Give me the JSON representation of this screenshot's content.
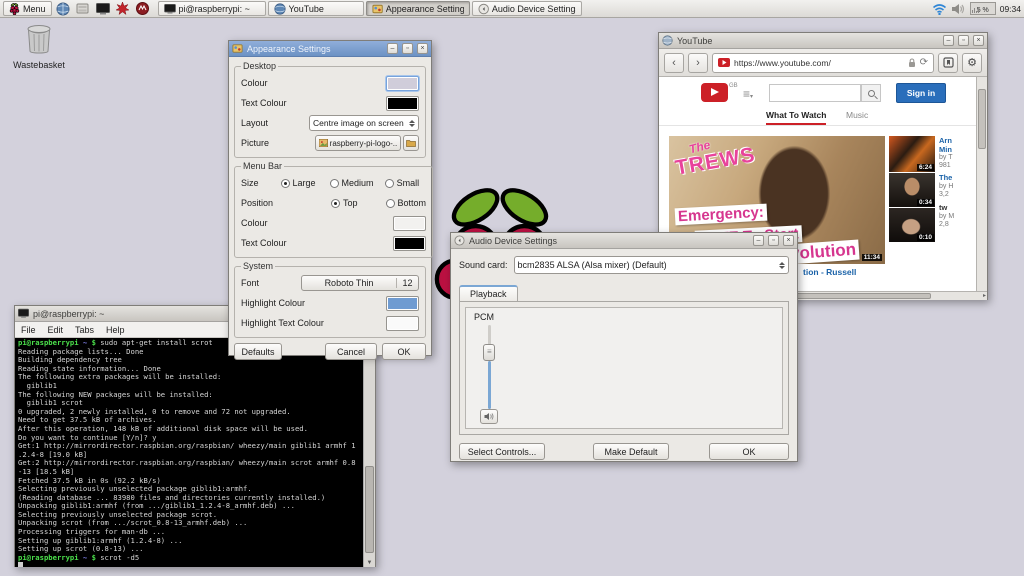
{
  "colors": {
    "desktop_bg": "#d3d1dc",
    "active_titlebar_blue": "#7d9fd0",
    "desktop_colour_swatch": "#d3d1dc",
    "text_colour_swatch": "#000000",
    "menubar_colour_swatch": "#f2f1ef",
    "highlight_colour_swatch": "#6f9bd1",
    "highlight_text_colour_swatch": "#fafafa",
    "youtube_red": "#cc2027",
    "signin_blue": "#2a6ebb",
    "thumb_pink": "#e8439b",
    "terminal_prompt_green": "#4be04b",
    "terminal_path_blue": "#8585f2"
  },
  "taskbar": {
    "menu_label": "Menu",
    "task_terminal": "pi@raspberrypi: ~",
    "task_youtube": "YouTube",
    "task_appearance": "Appearance Settings",
    "task_audio": "Audio Device Settings",
    "cpu": "5 %",
    "clock": "09:34"
  },
  "desktop": {
    "wastebasket_label": "Wastebasket"
  },
  "appearance": {
    "title": "Appearance Settings",
    "desktop_legend": "Desktop",
    "colour_label": "Colour",
    "text_colour_label": "Text Colour",
    "layout_label": "Layout",
    "layout_value": "Centre image on screen",
    "picture_label": "Picture",
    "picture_value": "raspberry-pi-logo-...",
    "menubar_legend": "Menu Bar",
    "size_label": "Size",
    "size_large": "Large",
    "size_medium": "Medium",
    "size_small": "Small",
    "position_label": "Position",
    "position_top": "Top",
    "position_bottom": "Bottom",
    "mb_colour_label": "Colour",
    "mb_text_colour_label": "Text Colour",
    "system_legend": "System",
    "font_label": "Font",
    "font_name": "Roboto Thin",
    "font_size": "12",
    "highlight_colour_label": "Highlight Colour",
    "highlight_text_colour_label": "Highlight Text Colour",
    "defaults_button": "Defaults",
    "cancel_button": "Cancel",
    "ok_button": "OK"
  },
  "audio": {
    "title": "Audio Device Settings",
    "sound_card_label": "Sound card:",
    "sound_card_value": "bcm2835 ALSA (Alsa mixer) (Default)",
    "playback_tab": "Playback",
    "channel_label": "PCM",
    "select_controls_button": "Select Controls...",
    "make_default_button": "Make Default",
    "ok_button": "OK"
  },
  "youtube": {
    "title": "YouTube",
    "url": "https://www.youtube.com/",
    "region": "GB",
    "signin_button": "Sign in",
    "tab_what_to_watch": "What To Watch",
    "tab_music": "Music",
    "thumb_brand_the": "The",
    "thumb_brand": "TREWS",
    "thumb_line1": "Emergency:",
    "thumb_line2": "VOTE To Start",
    "thumb_line3": "volution",
    "main_duration": "11:34",
    "main_title_visible": "tion - Russell",
    "side": [
      {
        "duration": "6:24",
        "title1": "Arn",
        "title2": "Min",
        "meta1": "by T",
        "meta2": "981"
      },
      {
        "duration": "0:34",
        "title1": "The",
        "title2": "",
        "meta1": "by H",
        "meta2": "3,2"
      },
      {
        "duration": "0:10",
        "title1": "tw",
        "title2": "",
        "meta1": "by M",
        "meta2": "2,8"
      }
    ]
  },
  "terminal": {
    "title": "pi@raspberrypi: ~",
    "menu_file": "File",
    "menu_edit": "Edit",
    "menu_tabs": "Tabs",
    "menu_help": "Help",
    "prompt_user": "pi@raspberrypi",
    "prompt_path": "~",
    "prompt_symbol": "$",
    "command1": "sudo apt-get install scrot",
    "command2": "scrot -d5",
    "output": [
      "Reading package lists... Done",
      "Building dependency tree",
      "Reading state information... Done",
      "The following extra packages will be installed:",
      "  giblib1",
      "The following NEW packages will be installed:",
      "  giblib1 scrot",
      "0 upgraded, 2 newly installed, 0 to remove and 72 not upgraded.",
      "Need to get 37.5 kB of archives.",
      "After this operation, 148 kB of additional disk space will be used.",
      "Do you want to continue [Y/n]? y",
      "Get:1 http://mirrordirector.raspbian.org/raspbian/ wheezy/main giblib1 armhf 1",
      ".2.4-8 [19.0 kB]",
      "Get:2 http://mirrordirector.raspbian.org/raspbian/ wheezy/main scrot armhf 0.8",
      "-13 [18.5 kB]",
      "Fetched 37.5 kB in 0s (92.2 kB/s)",
      "Selecting previously unselected package giblib1:armhf.",
      "(Reading database ... 83980 files and directories currently installed.)",
      "Unpacking giblib1:armhf (from .../giblib1_1.2.4-8_armhf.deb) ...",
      "Selecting previously unselected package scrot.",
      "Unpacking scrot (from .../scrot_0.8-13_armhf.deb) ...",
      "Processing triggers for man-db ...",
      "Setting up giblib1:armhf (1.2.4-8) ...",
      "Setting up scrot (0.8-13) ..."
    ]
  }
}
